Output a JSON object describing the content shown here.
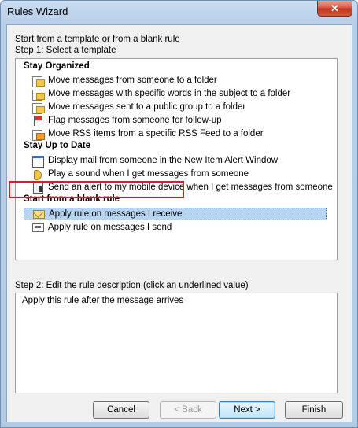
{
  "window": {
    "title": "Rules Wizard",
    "close_glyph": "✕"
  },
  "intro_text": "Start from a template or from a blank rule",
  "step1_label": "Step 1: Select a template",
  "groups": [
    {
      "header": "Stay Organized",
      "items": [
        {
          "label": "Move messages from someone to a folder",
          "icon": "folder-move-icon"
        },
        {
          "label": "Move messages with specific words in the subject to a folder",
          "icon": "folder-move-icon"
        },
        {
          "label": "Move messages sent to a public group to a folder",
          "icon": "folder-move-icon"
        },
        {
          "label": "Flag messages from someone for follow-up",
          "icon": "flag-icon"
        },
        {
          "label": "Move RSS items from a specific RSS Feed to a folder",
          "icon": "rss-folder-icon"
        }
      ]
    },
    {
      "header": "Stay Up to Date",
      "items": [
        {
          "label": "Display mail from someone in the New Item Alert Window",
          "icon": "alert-window-icon"
        },
        {
          "label": "Play a sound when I get messages from someone",
          "icon": "sound-icon"
        },
        {
          "label": "Send an alert to my mobile device when I get messages from someone",
          "icon": "mobile-device-icon"
        }
      ]
    },
    {
      "header": "Start from a blank rule",
      "items": [
        {
          "label": "Apply rule on messages I receive",
          "icon": "envelope-icon",
          "selected": true
        },
        {
          "label": "Apply rule on messages I send",
          "icon": "send-mail-icon"
        }
      ]
    }
  ],
  "step2_label": "Step 2: Edit the rule description (click an underlined value)",
  "description": "Apply this rule after the message arrives",
  "buttons": {
    "cancel": "Cancel",
    "back": "< Back",
    "next": "Next >",
    "finish": "Finish"
  },
  "colors": {
    "selection": "#b7d4f1",
    "annotation_highlight": "#e0182b"
  }
}
